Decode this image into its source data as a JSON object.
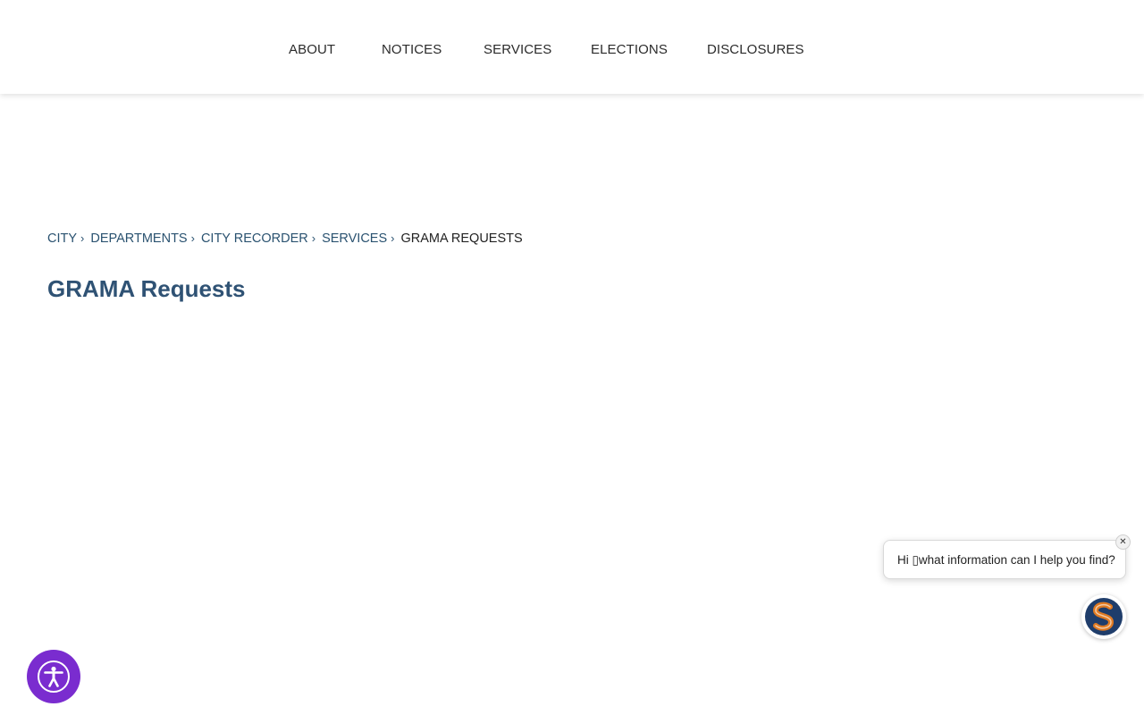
{
  "nav": {
    "items": [
      "ABOUT",
      "NOTICES",
      "SERVICES",
      "ELECTIONS",
      "DISCLOSURES"
    ]
  },
  "breadcrumb": {
    "items": [
      "CITY",
      "DEPARTMENTS",
      "CITY RECORDER",
      "SERVICES"
    ],
    "separator": "›",
    "current": "GRAMA REQUESTS"
  },
  "page": {
    "title": "GRAMA Requests"
  },
  "chat": {
    "greeting": "Hi ▯what information can I help you find?",
    "close_label": "✕",
    "avatar_icon": "chatbot-s-logo-icon",
    "colors": {
      "navy": "#1f3d6b",
      "orange": "#e07a22"
    }
  },
  "accessibility": {
    "icon": "accessibility-person-icon",
    "color": "#7a2ccf"
  }
}
